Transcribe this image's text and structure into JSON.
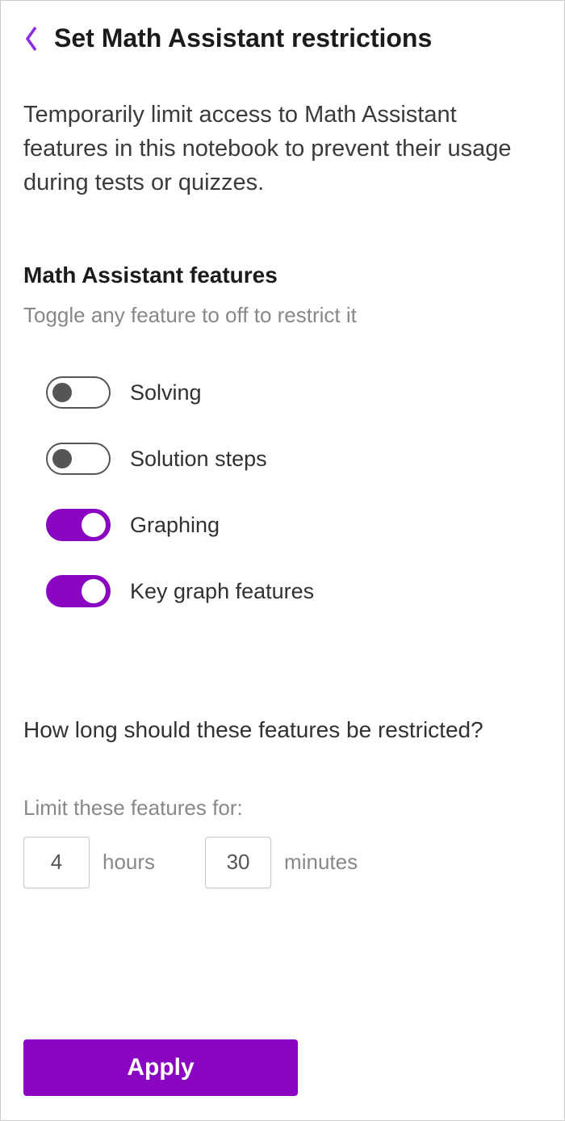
{
  "header": {
    "title": "Set Math Assistant restrictions"
  },
  "description": "Temporarily limit access to Math Assistant features in this notebook to prevent their usage during tests or quizzes.",
  "features_section": {
    "heading": "Math Assistant features",
    "subtext": "Toggle any feature to off to restrict it",
    "toggles": {
      "solving": {
        "label": "Solving",
        "on": false
      },
      "solution_steps": {
        "label": "Solution steps",
        "on": false
      },
      "graphing": {
        "label": "Graphing",
        "on": true
      },
      "key_graph_features": {
        "label": "Key graph features",
        "on": true
      }
    }
  },
  "duration_section": {
    "question": "How long should these features be restricted?",
    "subtext": "Limit these features for:",
    "hours_value": "4",
    "hours_unit": "hours",
    "minutes_value": "30",
    "minutes_unit": "minutes"
  },
  "apply_button": "Apply",
  "colors": {
    "accent": "#8a05c2"
  }
}
